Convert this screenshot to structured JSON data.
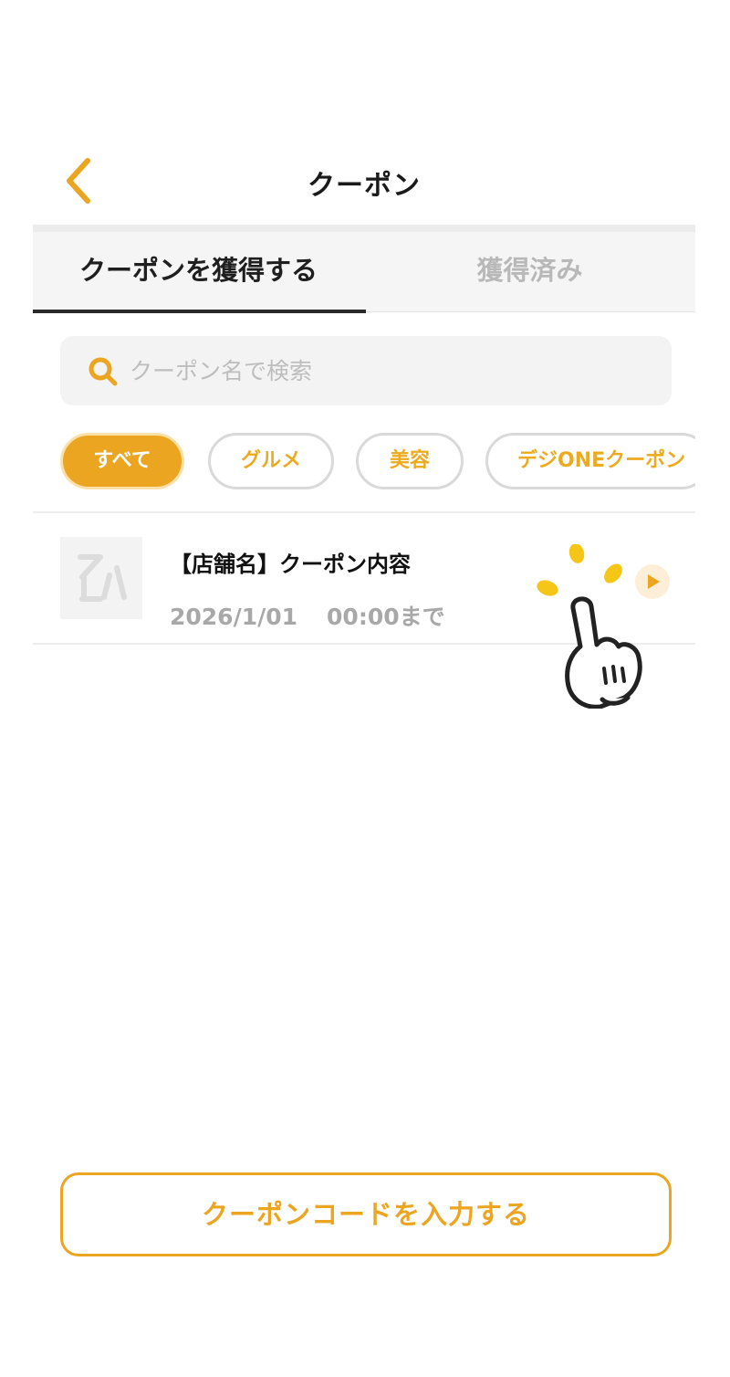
{
  "header": {
    "title": "クーポン",
    "back_icon": "chevron-left-icon"
  },
  "tabs": [
    {
      "label": "クーポンを獲得する",
      "active": true
    },
    {
      "label": "獲得済み",
      "active": false
    }
  ],
  "search": {
    "placeholder": "クーポン名で検索",
    "value": "",
    "icon": "search-icon"
  },
  "categories": [
    {
      "label": "すべて",
      "selected": true
    },
    {
      "label": "グルメ",
      "selected": false
    },
    {
      "label": "美容",
      "selected": false
    },
    {
      "label": "デジONEクーポン",
      "selected": false
    }
  ],
  "coupons": [
    {
      "title": "【店舗名】クーポン内容",
      "date": "2026/1/01",
      "time": "00:00まで",
      "arrow_icon": "play-arrow-icon"
    }
  ],
  "footer": {
    "code_button_label": "クーポンコードを入力する"
  },
  "colors": {
    "accent": "#eba521",
    "accent_light": "#fdeed8",
    "hand_sparkle": "#f5c518"
  }
}
